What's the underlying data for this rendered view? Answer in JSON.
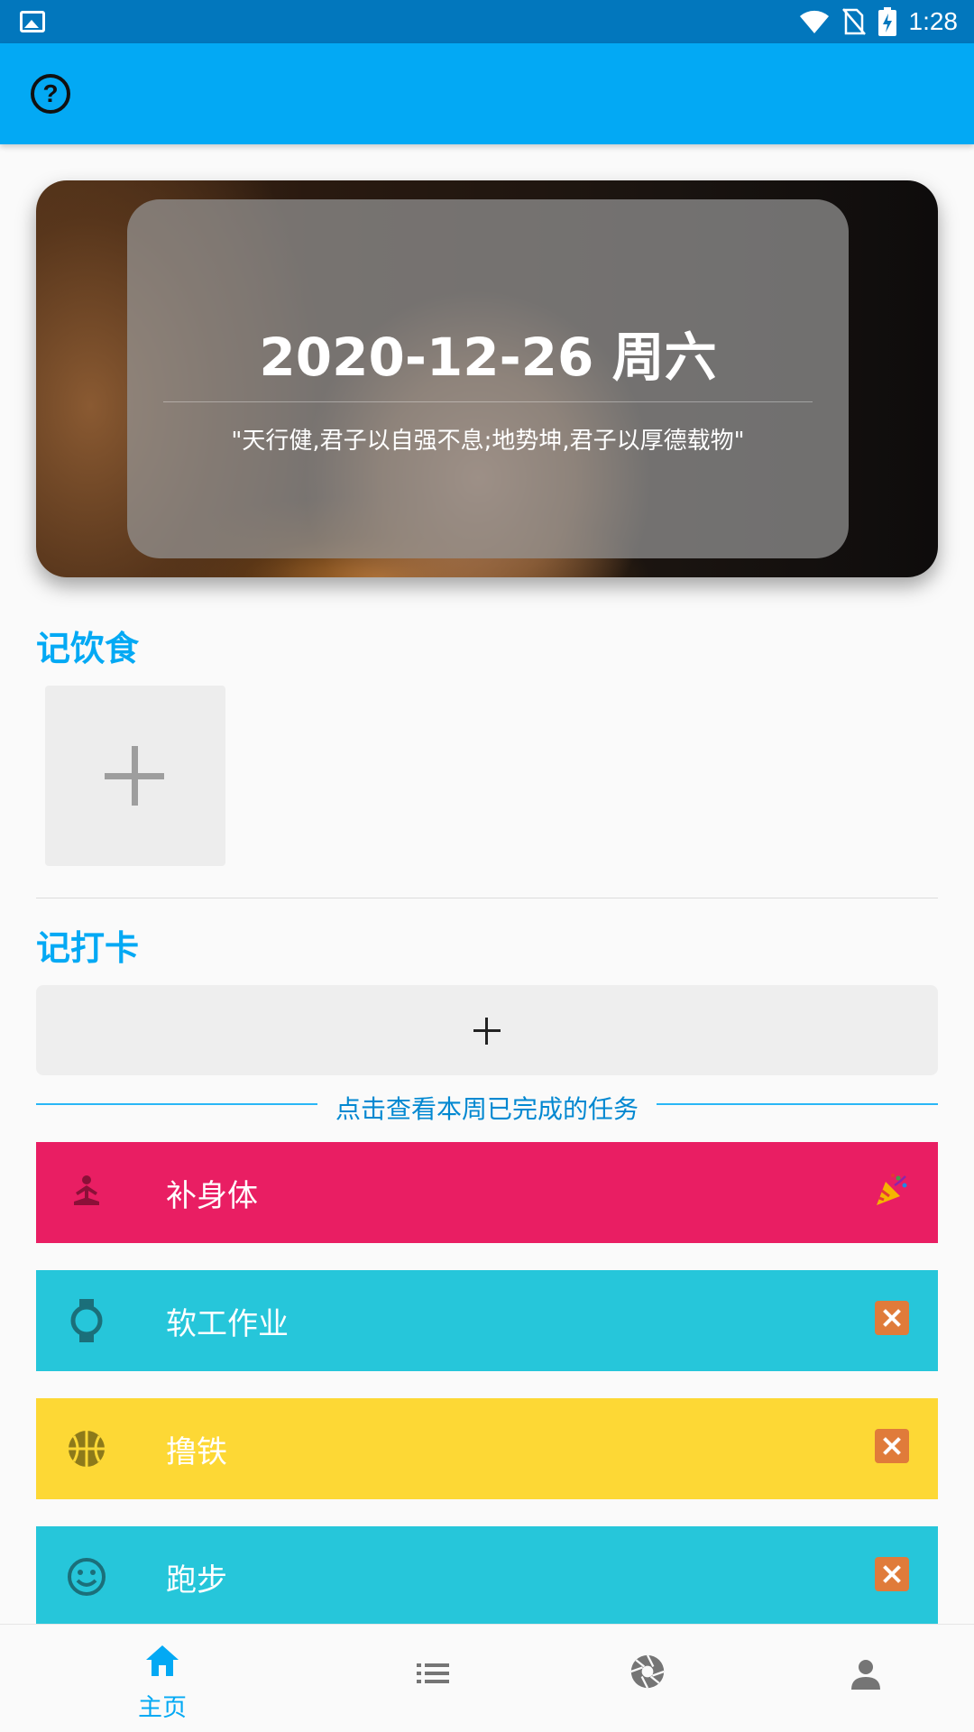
{
  "status_bar": {
    "time": "1:28"
  },
  "app_bar": {
    "help_icon": "help-circle-icon"
  },
  "hero": {
    "date": "2020-12-26 周六",
    "quote": "\"天行健,君子以自强不息;地势坤,君子以厚德载物\""
  },
  "diet": {
    "title": "记饮食"
  },
  "checkin": {
    "title": "记打卡",
    "week_link": "点击查看本周已完成的任务"
  },
  "tasks": [
    {
      "name": "补身体",
      "icon": "meditation-icon",
      "status": "party-popper-icon",
      "color": "#e91e63"
    },
    {
      "name": "软工作业",
      "icon": "watch-icon",
      "status": "cross-mark-icon",
      "color": "#26c6da"
    },
    {
      "name": "撸铁",
      "icon": "basketball-icon",
      "status": "cross-mark-icon",
      "color": "#fdd835"
    },
    {
      "name": "跑步",
      "icon": "smiley-icon",
      "status": "cross-mark-icon",
      "color": "#26c6da"
    }
  ],
  "bottom_nav": {
    "home_label": "主页",
    "items": [
      "home-icon",
      "list-icon",
      "aperture-icon",
      "person-icon"
    ],
    "active_color": "#03a9f4"
  }
}
